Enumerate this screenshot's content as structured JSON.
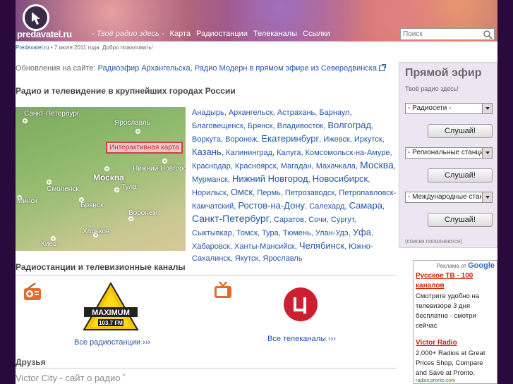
{
  "header": {
    "logo_text": "predavatel.ru",
    "slogan": "- Твоё радио здесь -",
    "nav": [
      "Карта",
      "Радиостанции",
      "Телеканалы",
      "Ссылки"
    ],
    "search_placeholder": "Поиск"
  },
  "statusbar": {
    "site": "Predavatel.ru",
    "text": " • 7 июля 2011 года: Добро пожаловать!"
  },
  "updates": {
    "label": "Обновления на сайте: ",
    "link1": "Радиоэфир Архангельска",
    "sep": ", ",
    "link2": "Радио Модерн в прямом эфире из Северодвинска"
  },
  "section_title": "Радио и телевидение в крупнейших городах России",
  "map": {
    "label": "Интерактивная карта",
    "cities": [
      "Санкт-Петербург",
      "Ярославль",
      "Москва",
      "Нижний Новгород",
      "Смоленск",
      "Тула",
      "Минск",
      "Брянск",
      "Воронеж",
      "Харьков",
      "Киев"
    ]
  },
  "cities_list": [
    {
      "t": "Анадырь",
      "s": ""
    },
    {
      "t": "Архангельск",
      "s": ""
    },
    {
      "t": "Астрахань",
      "s": ""
    },
    {
      "t": "Барнаул",
      "s": ""
    },
    {
      "t": "Благовещенск",
      "s": ""
    },
    {
      "t": "Брянск",
      "s": ""
    },
    {
      "t": "Владивосток",
      "s": ""
    },
    {
      "t": "Волгоград",
      "s": "big"
    },
    {
      "t": "Воркута",
      "s": ""
    },
    {
      "t": "Воронеж",
      "s": ""
    },
    {
      "t": "Екатеринбург",
      "s": "big"
    },
    {
      "t": "Ижевск",
      "s": ""
    },
    {
      "t": "Иркутск",
      "s": ""
    },
    {
      "t": "Казань",
      "s": "big"
    },
    {
      "t": "Калининград",
      "s": ""
    },
    {
      "t": "Калуга",
      "s": ""
    },
    {
      "t": "Комсомольск-на-Амуре",
      "s": ""
    },
    {
      "t": "Краснодар",
      "s": ""
    },
    {
      "t": "Красноярск",
      "s": ""
    },
    {
      "t": "Магадан",
      "s": ""
    },
    {
      "t": "Махачкала",
      "s": ""
    },
    {
      "t": "Москва",
      "s": "bigger"
    },
    {
      "t": "Мурманск",
      "s": ""
    },
    {
      "t": "Нижний Новгород",
      "s": "big"
    },
    {
      "t": "Новосибирск",
      "s": "big"
    },
    {
      "t": "Норильск",
      "s": ""
    },
    {
      "t": "Омск",
      "s": "big"
    },
    {
      "t": "Пермь",
      "s": ""
    },
    {
      "t": "Петрозаводск",
      "s": ""
    },
    {
      "t": "Петропавловск-Камчатский",
      "s": ""
    },
    {
      "t": "Ростов-на-Дону",
      "s": "big"
    },
    {
      "t": "Салехард",
      "s": ""
    },
    {
      "t": "Самара",
      "s": "big"
    },
    {
      "t": "Санкт-Петербург",
      "s": "bigger"
    },
    {
      "t": "Саратов",
      "s": ""
    },
    {
      "t": "Сочи",
      "s": ""
    },
    {
      "t": "Сургут",
      "s": ""
    },
    {
      "t": "Сыктывкар",
      "s": ""
    },
    {
      "t": "Томск",
      "s": ""
    },
    {
      "t": "Тура",
      "s": ""
    },
    {
      "t": "Тюмень",
      "s": ""
    },
    {
      "t": "Улан-Удэ",
      "s": ""
    },
    {
      "t": "Уфа",
      "s": "big"
    },
    {
      "t": "Хабаровск",
      "s": ""
    },
    {
      "t": "Ханты-Мансийск",
      "s": ""
    },
    {
      "t": "Челябинск",
      "s": "big"
    },
    {
      "t": "Южно-Сахалинск",
      "s": ""
    },
    {
      "t": "Якутск",
      "s": ""
    },
    {
      "t": "Ярославль",
      "s": ""
    }
  ],
  "channels": {
    "title": "Радиостанции и телевизионные каналы",
    "radio_logo_text": "MAXIMUM",
    "radio_logo_freq": "103.7 FM",
    "all_radio": "Все радиостанции ›››",
    "all_tv": "Все телеканалы ›››"
  },
  "friends": {
    "title": "Друзья",
    "link": "Victor City - сайт о радио"
  },
  "live": {
    "title": "Прямой эфир",
    "tagline": "Твоё радио здесь!",
    "select1": "- Радиосети -",
    "select2": "- Региональные станции",
    "select3": "- Международные станции",
    "button": "Слушай!",
    "note": "(списки пополняются)"
  },
  "ad": {
    "header_prefix": "Реклама от ",
    "header_brand": "Google",
    "title1": "Русское ТВ - 100 каналов",
    "text1": "Смотрите удобно на телевизоре 3 дня бесплатно - смотри сейчас",
    "title2": "Victor Radio",
    "text2": "2,000+ Radios at Great Prices Shop, Compare and Save at Pronto.",
    "url2": "radios.pronto.com"
  }
}
